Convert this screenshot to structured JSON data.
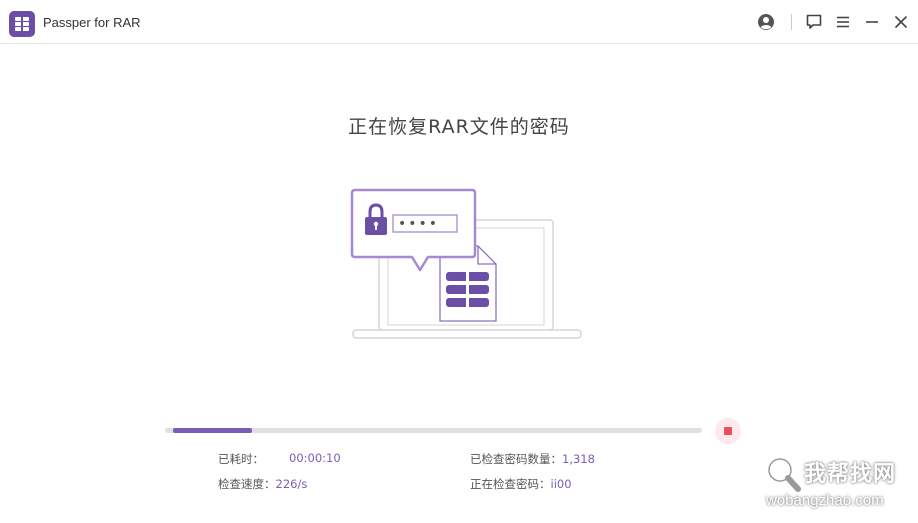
{
  "window": {
    "title": "Passper for RAR",
    "icons": [
      "app-logo-icon",
      "user-icon",
      "feedback-icon",
      "menu-icon",
      "minimize-icon",
      "close-icon"
    ]
  },
  "main": {
    "heading": "正在恢复RAR文件的密码",
    "password_mask": "••••"
  },
  "progress": {
    "fraction": 0.25,
    "fill_color": "#7a5db8"
  },
  "stats": {
    "elapsed_label": "已耗时：",
    "elapsed_value": "00:00:10",
    "speed_label": "检查速度：",
    "speed_value": "226/s",
    "checked_label": "已检查密码数量：",
    "checked_value": "1,318",
    "current_label": "正在检查密码：",
    "current_value": "ii00"
  },
  "watermark": {
    "cn": "我帮找网",
    "en": "wobangzhao.com"
  },
  "colors": {
    "accent": "#7a5db8",
    "stop": "#e8505b"
  }
}
